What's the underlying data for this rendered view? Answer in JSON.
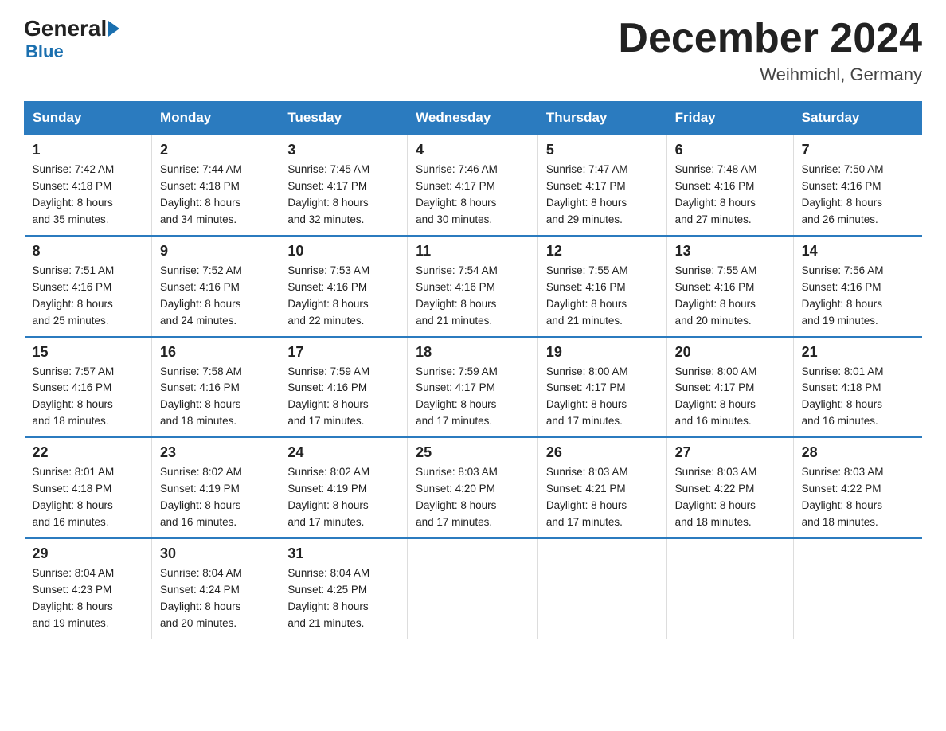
{
  "header": {
    "logo_general": "General",
    "logo_blue": "Blue",
    "month_title": "December 2024",
    "location": "Weihmichl, Germany"
  },
  "days_of_week": [
    "Sunday",
    "Monday",
    "Tuesday",
    "Wednesday",
    "Thursday",
    "Friday",
    "Saturday"
  ],
  "weeks": [
    [
      {
        "day": "1",
        "sunrise": "7:42 AM",
        "sunset": "4:18 PM",
        "daylight": "8 hours and 35 minutes."
      },
      {
        "day": "2",
        "sunrise": "7:44 AM",
        "sunset": "4:18 PM",
        "daylight": "8 hours and 34 minutes."
      },
      {
        "day": "3",
        "sunrise": "7:45 AM",
        "sunset": "4:17 PM",
        "daylight": "8 hours and 32 minutes."
      },
      {
        "day": "4",
        "sunrise": "7:46 AM",
        "sunset": "4:17 PM",
        "daylight": "8 hours and 30 minutes."
      },
      {
        "day": "5",
        "sunrise": "7:47 AM",
        "sunset": "4:17 PM",
        "daylight": "8 hours and 29 minutes."
      },
      {
        "day": "6",
        "sunrise": "7:48 AM",
        "sunset": "4:16 PM",
        "daylight": "8 hours and 27 minutes."
      },
      {
        "day": "7",
        "sunrise": "7:50 AM",
        "sunset": "4:16 PM",
        "daylight": "8 hours and 26 minutes."
      }
    ],
    [
      {
        "day": "8",
        "sunrise": "7:51 AM",
        "sunset": "4:16 PM",
        "daylight": "8 hours and 25 minutes."
      },
      {
        "day": "9",
        "sunrise": "7:52 AM",
        "sunset": "4:16 PM",
        "daylight": "8 hours and 24 minutes."
      },
      {
        "day": "10",
        "sunrise": "7:53 AM",
        "sunset": "4:16 PM",
        "daylight": "8 hours and 22 minutes."
      },
      {
        "day": "11",
        "sunrise": "7:54 AM",
        "sunset": "4:16 PM",
        "daylight": "8 hours and 21 minutes."
      },
      {
        "day": "12",
        "sunrise": "7:55 AM",
        "sunset": "4:16 PM",
        "daylight": "8 hours and 21 minutes."
      },
      {
        "day": "13",
        "sunrise": "7:55 AM",
        "sunset": "4:16 PM",
        "daylight": "8 hours and 20 minutes."
      },
      {
        "day": "14",
        "sunrise": "7:56 AM",
        "sunset": "4:16 PM",
        "daylight": "8 hours and 19 minutes."
      }
    ],
    [
      {
        "day": "15",
        "sunrise": "7:57 AM",
        "sunset": "4:16 PM",
        "daylight": "8 hours and 18 minutes."
      },
      {
        "day": "16",
        "sunrise": "7:58 AM",
        "sunset": "4:16 PM",
        "daylight": "8 hours and 18 minutes."
      },
      {
        "day": "17",
        "sunrise": "7:59 AM",
        "sunset": "4:16 PM",
        "daylight": "8 hours and 17 minutes."
      },
      {
        "day": "18",
        "sunrise": "7:59 AM",
        "sunset": "4:17 PM",
        "daylight": "8 hours and 17 minutes."
      },
      {
        "day": "19",
        "sunrise": "8:00 AM",
        "sunset": "4:17 PM",
        "daylight": "8 hours and 17 minutes."
      },
      {
        "day": "20",
        "sunrise": "8:00 AM",
        "sunset": "4:17 PM",
        "daylight": "8 hours and 16 minutes."
      },
      {
        "day": "21",
        "sunrise": "8:01 AM",
        "sunset": "4:18 PM",
        "daylight": "8 hours and 16 minutes."
      }
    ],
    [
      {
        "day": "22",
        "sunrise": "8:01 AM",
        "sunset": "4:18 PM",
        "daylight": "8 hours and 16 minutes."
      },
      {
        "day": "23",
        "sunrise": "8:02 AM",
        "sunset": "4:19 PM",
        "daylight": "8 hours and 16 minutes."
      },
      {
        "day": "24",
        "sunrise": "8:02 AM",
        "sunset": "4:19 PM",
        "daylight": "8 hours and 17 minutes."
      },
      {
        "day": "25",
        "sunrise": "8:03 AM",
        "sunset": "4:20 PM",
        "daylight": "8 hours and 17 minutes."
      },
      {
        "day": "26",
        "sunrise": "8:03 AM",
        "sunset": "4:21 PM",
        "daylight": "8 hours and 17 minutes."
      },
      {
        "day": "27",
        "sunrise": "8:03 AM",
        "sunset": "4:22 PM",
        "daylight": "8 hours and 18 minutes."
      },
      {
        "day": "28",
        "sunrise": "8:03 AM",
        "sunset": "4:22 PM",
        "daylight": "8 hours and 18 minutes."
      }
    ],
    [
      {
        "day": "29",
        "sunrise": "8:04 AM",
        "sunset": "4:23 PM",
        "daylight": "8 hours and 19 minutes."
      },
      {
        "day": "30",
        "sunrise": "8:04 AM",
        "sunset": "4:24 PM",
        "daylight": "8 hours and 20 minutes."
      },
      {
        "day": "31",
        "sunrise": "8:04 AM",
        "sunset": "4:25 PM",
        "daylight": "8 hours and 21 minutes."
      },
      null,
      null,
      null,
      null
    ]
  ],
  "labels": {
    "sunrise": "Sunrise:",
    "sunset": "Sunset:",
    "daylight": "Daylight:"
  }
}
